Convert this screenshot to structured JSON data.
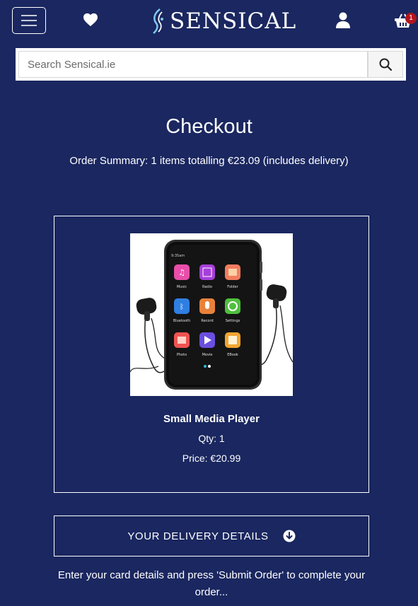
{
  "header": {
    "brand": "SENSICAL",
    "basket_count": "1"
  },
  "icons": {
    "menu": "hamburger-icon",
    "wishlist": "heart-icon",
    "logo": "sensical-logo-icon",
    "account": "user-icon",
    "basket": "basket-icon",
    "search": "search-icon",
    "expand": "chevron-down-circle-icon"
  },
  "search": {
    "placeholder": "Search Sensical.ie"
  },
  "checkout": {
    "title": "Checkout",
    "summary": "Order Summary: 1 items totalling €23.09 (includes delivery)"
  },
  "product": {
    "name": "Small Media Player",
    "qty": "Qty: 1",
    "price": "Price: €20.99",
    "screen_time": "9:35am",
    "apps": [
      "Music",
      "Radio",
      "Folder",
      "Bluetooth",
      "Record",
      "Settings",
      "Photo",
      "Movie",
      "EBook"
    ]
  },
  "delivery": {
    "label": "YOUR DELIVERY DETAILS"
  },
  "instruction": "Enter your card details and press 'Submit Order' to complete your order...",
  "colors": {
    "background": "#1a2760",
    "badge": "#b3151b",
    "text": "#ffffff"
  }
}
